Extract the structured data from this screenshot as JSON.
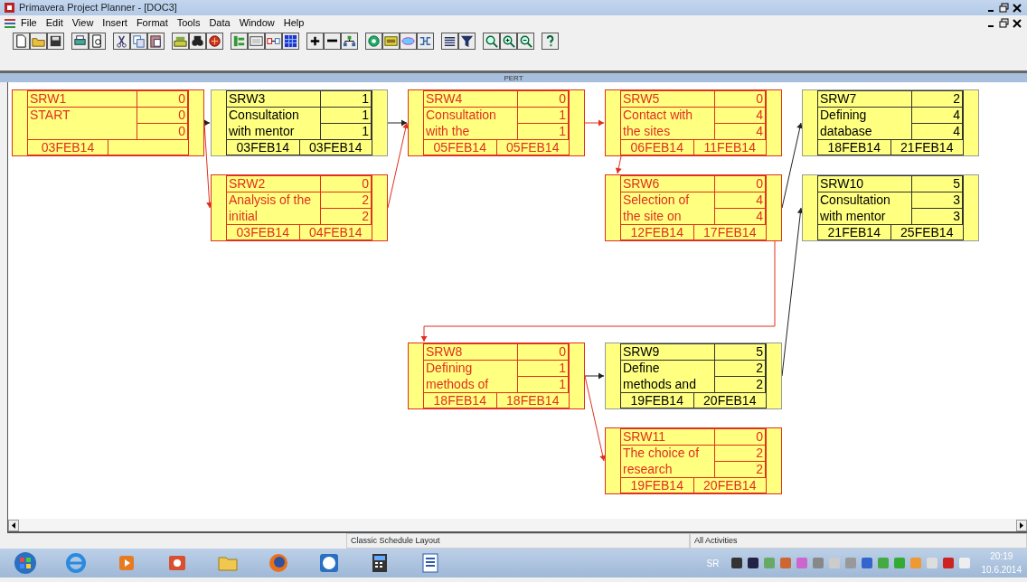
{
  "window": {
    "title": "Primavera Project Planner - [DOC3]"
  },
  "menu": [
    {
      "label": "File"
    },
    {
      "label": "Edit"
    },
    {
      "label": "View"
    },
    {
      "label": "Insert"
    },
    {
      "label": "Format"
    },
    {
      "label": "Tools"
    },
    {
      "label": "Data"
    },
    {
      "label": "Window"
    },
    {
      "label": "Help"
    }
  ],
  "view": {
    "title": "PERT"
  },
  "activities": [
    {
      "id": "SRW1",
      "description_lines": [
        "START"
      ],
      "numbers": [
        "0",
        "0",
        "0"
      ],
      "dates": [
        "03FEB14"
      ],
      "critical": true
    },
    {
      "id": "SRW3",
      "description_lines": [
        "Consultation",
        "with mentor"
      ],
      "numbers": [
        "1",
        "1",
        "1"
      ],
      "dates": [
        "03FEB14",
        "03FEB14"
      ],
      "critical": false
    },
    {
      "id": "SRW2",
      "description_lines": [
        "Analysis of the",
        "initial"
      ],
      "numbers": [
        "0",
        "2",
        "2"
      ],
      "dates": [
        "03FEB14",
        "04FEB14"
      ],
      "critical": true
    },
    {
      "id": "SRW4",
      "description_lines": [
        "Consultation",
        "with the"
      ],
      "numbers": [
        "0",
        "1",
        "1"
      ],
      "dates": [
        "05FEB14",
        "05FEB14"
      ],
      "critical": true
    },
    {
      "id": "SRW5",
      "description_lines": [
        "Contact with",
        "the sites"
      ],
      "numbers": [
        "0",
        "4",
        "4"
      ],
      "dates": [
        "06FEB14",
        "11FEB14"
      ],
      "critical": true
    },
    {
      "id": "SRW6",
      "description_lines": [
        "Selection of",
        "the site on"
      ],
      "numbers": [
        "0",
        "4",
        "4"
      ],
      "dates": [
        "12FEB14",
        "17FEB14"
      ],
      "critical": true
    },
    {
      "id": "SRW7",
      "description_lines": [
        "Defining",
        "database"
      ],
      "numbers": [
        "2",
        "4",
        "4"
      ],
      "dates": [
        "18FEB14",
        "21FEB14"
      ],
      "critical": false
    },
    {
      "id": "SRW10",
      "description_lines": [
        "Consultation",
        "with mentor"
      ],
      "numbers": [
        "5",
        "3",
        "3"
      ],
      "dates": [
        "21FEB14",
        "25FEB14"
      ],
      "critical": false
    },
    {
      "id": "SRW8",
      "description_lines": [
        "Defining",
        "methods of"
      ],
      "numbers": [
        "0",
        "1",
        "1"
      ],
      "dates": [
        "18FEB14",
        "18FEB14"
      ],
      "critical": true
    },
    {
      "id": "SRW9",
      "description_lines": [
        "Define",
        "methods and"
      ],
      "numbers": [
        "5",
        "2",
        "2"
      ],
      "dates": [
        "19FEB14",
        "20FEB14"
      ],
      "critical": false
    },
    {
      "id": "SRW11",
      "description_lines": [
        "The choice of",
        "research"
      ],
      "numbers": [
        "0",
        "2",
        "2"
      ],
      "dates": [
        "19FEB14",
        "20FEB14"
      ],
      "critical": true
    }
  ],
  "links": [
    {
      "critical": false
    },
    {
      "critical": true
    },
    {
      "critical": false
    },
    {
      "critical": true
    },
    {
      "critical": true
    },
    {
      "critical": true
    },
    {
      "critical": false
    },
    {
      "critical": true
    },
    {
      "critical": false
    },
    {
      "critical": true
    },
    {
      "critical": false
    }
  ],
  "status_bar": {
    "layout": "Classic Schedule Layout",
    "filter": "All Activities"
  },
  "taskbar": {
    "language": "SR",
    "time": "20:19",
    "date": "10.6.2014"
  }
}
